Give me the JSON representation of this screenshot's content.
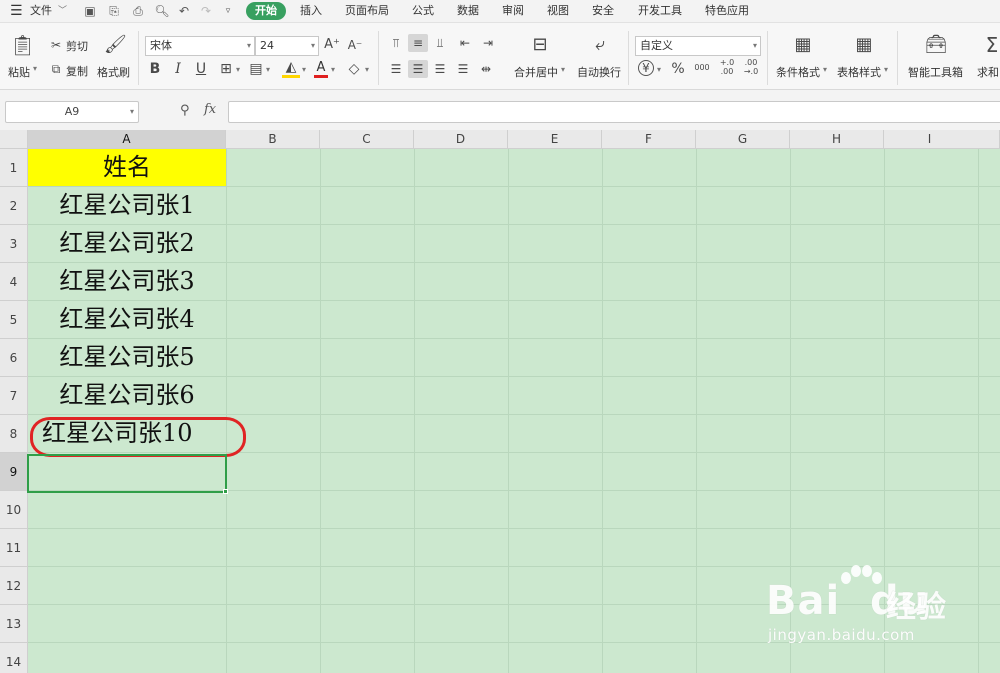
{
  "menu": {
    "file": "文件",
    "tabs": [
      "开始",
      "插入",
      "页面布局",
      "公式",
      "数据",
      "审阅",
      "视图",
      "安全",
      "开发工具",
      "特色应用"
    ]
  },
  "ribbon": {
    "paste": "粘贴",
    "cut": "剪切",
    "copy": "复制",
    "format_painter": "格式刷",
    "font_name": "宋体",
    "font_size": "24",
    "bold": "B",
    "italic": "I",
    "underline": "U",
    "merge_center": "合并居中",
    "wrap_text": "自动换行",
    "number_format": "自定义",
    "currency": "¥",
    "percent": "%",
    "thousands": "000",
    "inc_decimal": "+.0\n.00",
    "dec_decimal": ".00\n→.0",
    "conditional_format": "条件格式",
    "table_style": "表格样式",
    "smart_toolbox": "智能工具箱",
    "sum": "求和"
  },
  "formula_bar": {
    "name_box": "A9",
    "fx": "fx"
  },
  "columns": [
    "A",
    "B",
    "C",
    "D",
    "E",
    "F",
    "G",
    "H",
    "I"
  ],
  "rows": [
    "1",
    "2",
    "3",
    "4",
    "5",
    "6",
    "7",
    "8",
    "9",
    "10",
    "11",
    "12",
    "13",
    "14"
  ],
  "cells": {
    "header": "姓名",
    "values": [
      "红星公司张1",
      "红星公司张2",
      "红星公司张3",
      "红星公司张4",
      "红星公司张5",
      "红星公司张6",
      "红星公司张10"
    ]
  },
  "watermark": {
    "logo": "Bai  du",
    "cn": "经验",
    "url": "jingyan.baidu.com"
  },
  "colors": {
    "accent": "#38a060",
    "selection": "#2f9e48",
    "grid_background": "#cce8cf",
    "header_fill": "#ffff00",
    "annotation": "#e02424"
  }
}
